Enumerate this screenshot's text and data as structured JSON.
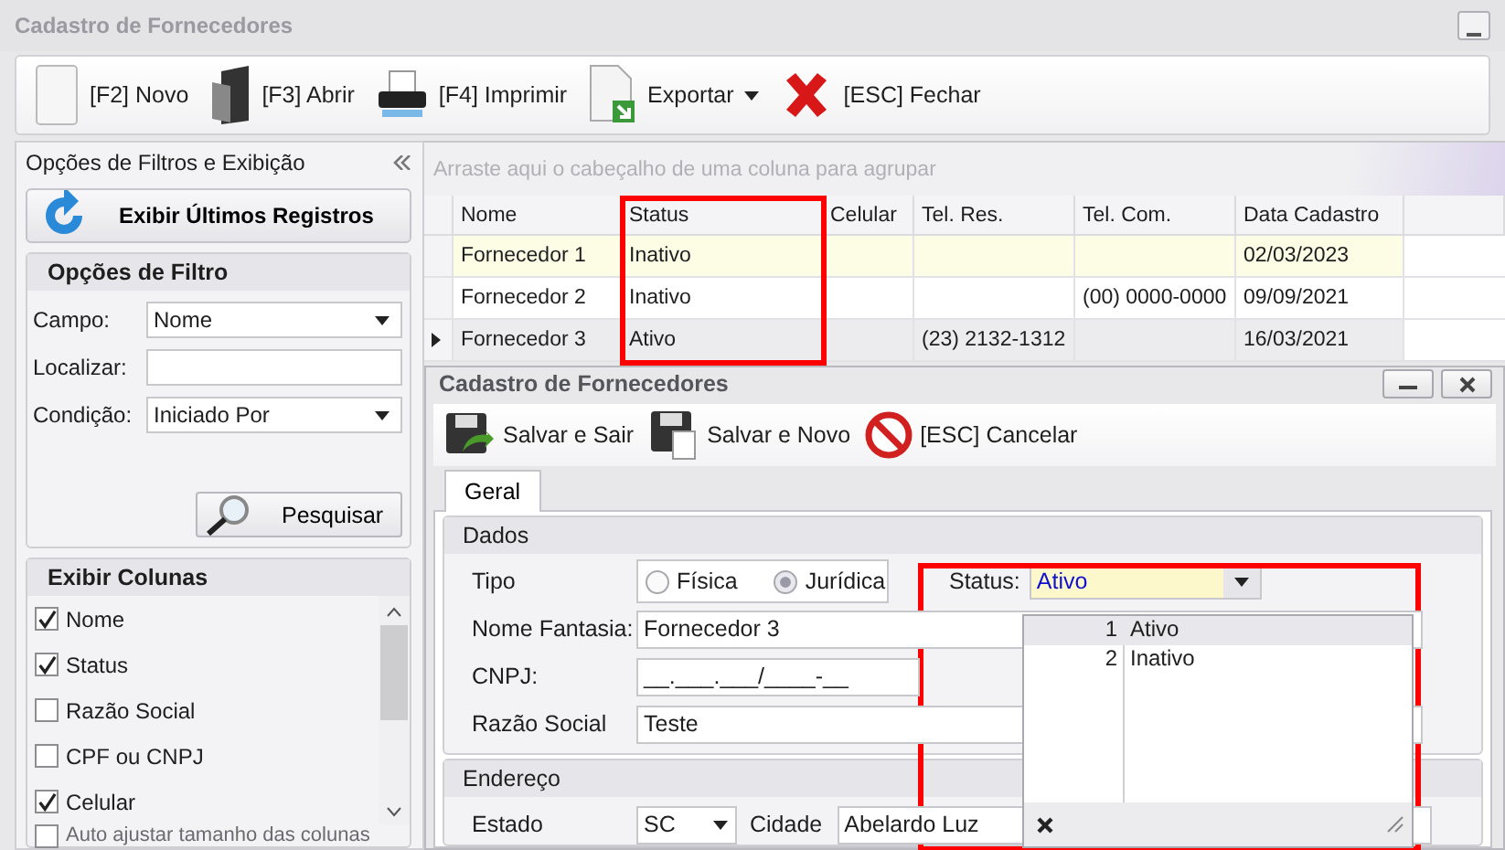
{
  "window": {
    "title": "Cadastro de Fornecedores"
  },
  "toolbar": [
    {
      "label": "[F2] Novo",
      "kind": "new",
      "dropdown": false
    },
    {
      "label": "[F3] Abrir",
      "kind": "open",
      "dropdown": false
    },
    {
      "label": "[F4] Imprimir",
      "kind": "print",
      "dropdown": false
    },
    {
      "label": "Exportar",
      "kind": "export",
      "dropdown": true
    },
    {
      "label": "[ESC] Fechar",
      "kind": "close",
      "dropdown": false
    }
  ],
  "filter_panel": {
    "title": "Opções de Filtros e Exibição",
    "show_latest_button": "Exibir Últimos Registros",
    "filter_group": {
      "title": "Opções de Filtro",
      "fields": [
        {
          "label": "Campo:",
          "value": "Nome",
          "kind": "combo"
        },
        {
          "label": "Localizar:",
          "kind": "text"
        },
        {
          "label": "Condição:",
          "value": "Iniciado Por",
          "kind": "combo"
        }
      ],
      "search_button": "Pesquisar"
    },
    "columns_group": {
      "title": "Exibir Colunas",
      "items": [
        {
          "label": "Nome",
          "checked": true
        },
        {
          "label": "Status",
          "checked": true
        },
        {
          "label": "Razão Social",
          "checked": false
        },
        {
          "label": "CPF ou CNPJ",
          "checked": false
        },
        {
          "label": "Celular",
          "checked": true
        }
      ],
      "auto_fit": {
        "label": "Auto ajustar tamanho das colunas",
        "checked": false
      }
    }
  },
  "grid": {
    "group_hint": "Arraste aqui o cabeçalho de uma coluna para agrupar",
    "columns": [
      "Nome",
      "Status",
      "Celular",
      "Tel. Res.",
      "Tel. Com.",
      "Data Cadastro"
    ],
    "rows": [
      {
        "cells": [
          "Fornecedor 1",
          "Inativo",
          "",
          "",
          "",
          "02/03/2023"
        ],
        "selected": false,
        "hovered": true
      },
      {
        "cells": [
          "Fornecedor 2",
          "Inativo",
          "",
          "",
          "(00) 0000-0000",
          "09/09/2021"
        ],
        "selected": false,
        "hovered": false
      },
      {
        "cells": [
          "Fornecedor 3",
          "Ativo",
          "",
          "(23) 2132-1312",
          "",
          "16/03/2021"
        ],
        "selected": true,
        "hovered": false
      }
    ]
  },
  "dialog": {
    "title": "Cadastro de Fornecedores",
    "toolbar": [
      {
        "label": "Salvar e Sair",
        "kind": "save_exit"
      },
      {
        "label": "Salvar e Novo",
        "kind": "save_new"
      },
      {
        "label": "[ESC] Cancelar",
        "kind": "cancel"
      }
    ],
    "tabs": [
      {
        "label": "Geral",
        "selected": true
      }
    ],
    "dados": {
      "title": "Dados",
      "tipo": {
        "label": "Tipo",
        "options": [
          {
            "label": "Física",
            "selected": false
          },
          {
            "label": "Jurídica",
            "selected": true
          }
        ]
      },
      "status": {
        "label": "Status:",
        "value": "Ativo",
        "open": true,
        "options": [
          {
            "index": "1",
            "label": "Ativo",
            "selected": true
          },
          {
            "index": "2",
            "label": "Inativo",
            "selected": false
          }
        ]
      },
      "fields": [
        {
          "label": "Nome Fantasia:",
          "value": "Fornecedor 3",
          "kind": "wide"
        },
        {
          "label": "CNPJ:",
          "value": "__.___.___/____-__",
          "kind": "short"
        },
        {
          "label": "Razão Social",
          "value": "Teste",
          "kind": "wide"
        }
      ]
    },
    "endereco": {
      "title": "Endereço",
      "estado": {
        "label": "Estado",
        "value": "SC"
      },
      "cidade": {
        "label": "Cidade",
        "value": "Abelardo Luz"
      }
    }
  }
}
